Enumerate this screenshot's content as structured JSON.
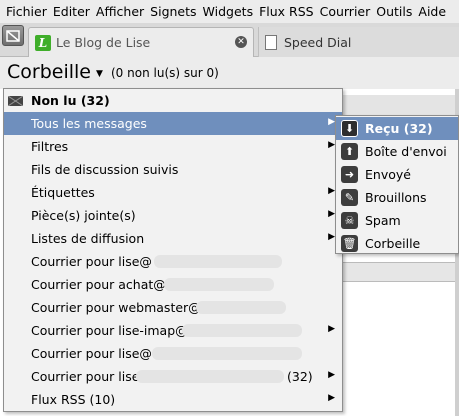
{
  "menubar": {
    "items": [
      "Fichier",
      "Editer",
      "Afficher",
      "Signets",
      "Widgets",
      "Flux RSS",
      "Courrier",
      "Outils",
      "Aide"
    ]
  },
  "tabs": [
    {
      "title": "Le Blog de Lise",
      "favicon_letter": "L",
      "favicon_color": "#3fae2a",
      "active": true
    },
    {
      "title": "Speed Dial",
      "active": false
    }
  ],
  "header": {
    "folder": "Corbeille",
    "count": "(0 non lu(s) sur 0)"
  },
  "menu": {
    "unread": "Non lu (32)",
    "items": [
      {
        "label": "Tous les messages",
        "submenu": true
      },
      {
        "label": "Filtres",
        "submenu": true
      },
      {
        "label": "Fils de discussion suivis",
        "submenu": false
      },
      {
        "label": "Étiquettes",
        "submenu": true
      },
      {
        "label": "Pièce(s) jointe(s)",
        "submenu": true
      },
      {
        "label": "Listes de diffusion",
        "submenu": true
      },
      {
        "label": "Courrier pour lise@",
        "submenu": false
      },
      {
        "label": "Courrier pour achat@",
        "submenu": false
      },
      {
        "label": "Courrier pour webmaster@",
        "submenu": false
      },
      {
        "label": "Courrier pour lise-imap@",
        "submenu": true
      },
      {
        "label": "Courrier pour lise@",
        "submenu": false
      },
      {
        "label": "Courrier pour lise",
        "count": "(32)",
        "submenu": true
      },
      {
        "label": "Flux RSS (10)",
        "submenu": true
      }
    ]
  },
  "submenu": {
    "items": [
      {
        "label": "Reçu (32)",
        "icon": "inbox-icon"
      },
      {
        "label": "Boîte d'envoi",
        "icon": "outbox-icon"
      },
      {
        "label": "Envoyé",
        "icon": "sent-icon"
      },
      {
        "label": "Brouillons",
        "icon": "drafts-icon"
      },
      {
        "label": "Spam",
        "icon": "spam-icon"
      },
      {
        "label": "Corbeille",
        "icon": "trash-icon"
      }
    ]
  },
  "colors": {
    "highlight": "#6f8fbd",
    "menu_bg": "#f2f2f2"
  }
}
